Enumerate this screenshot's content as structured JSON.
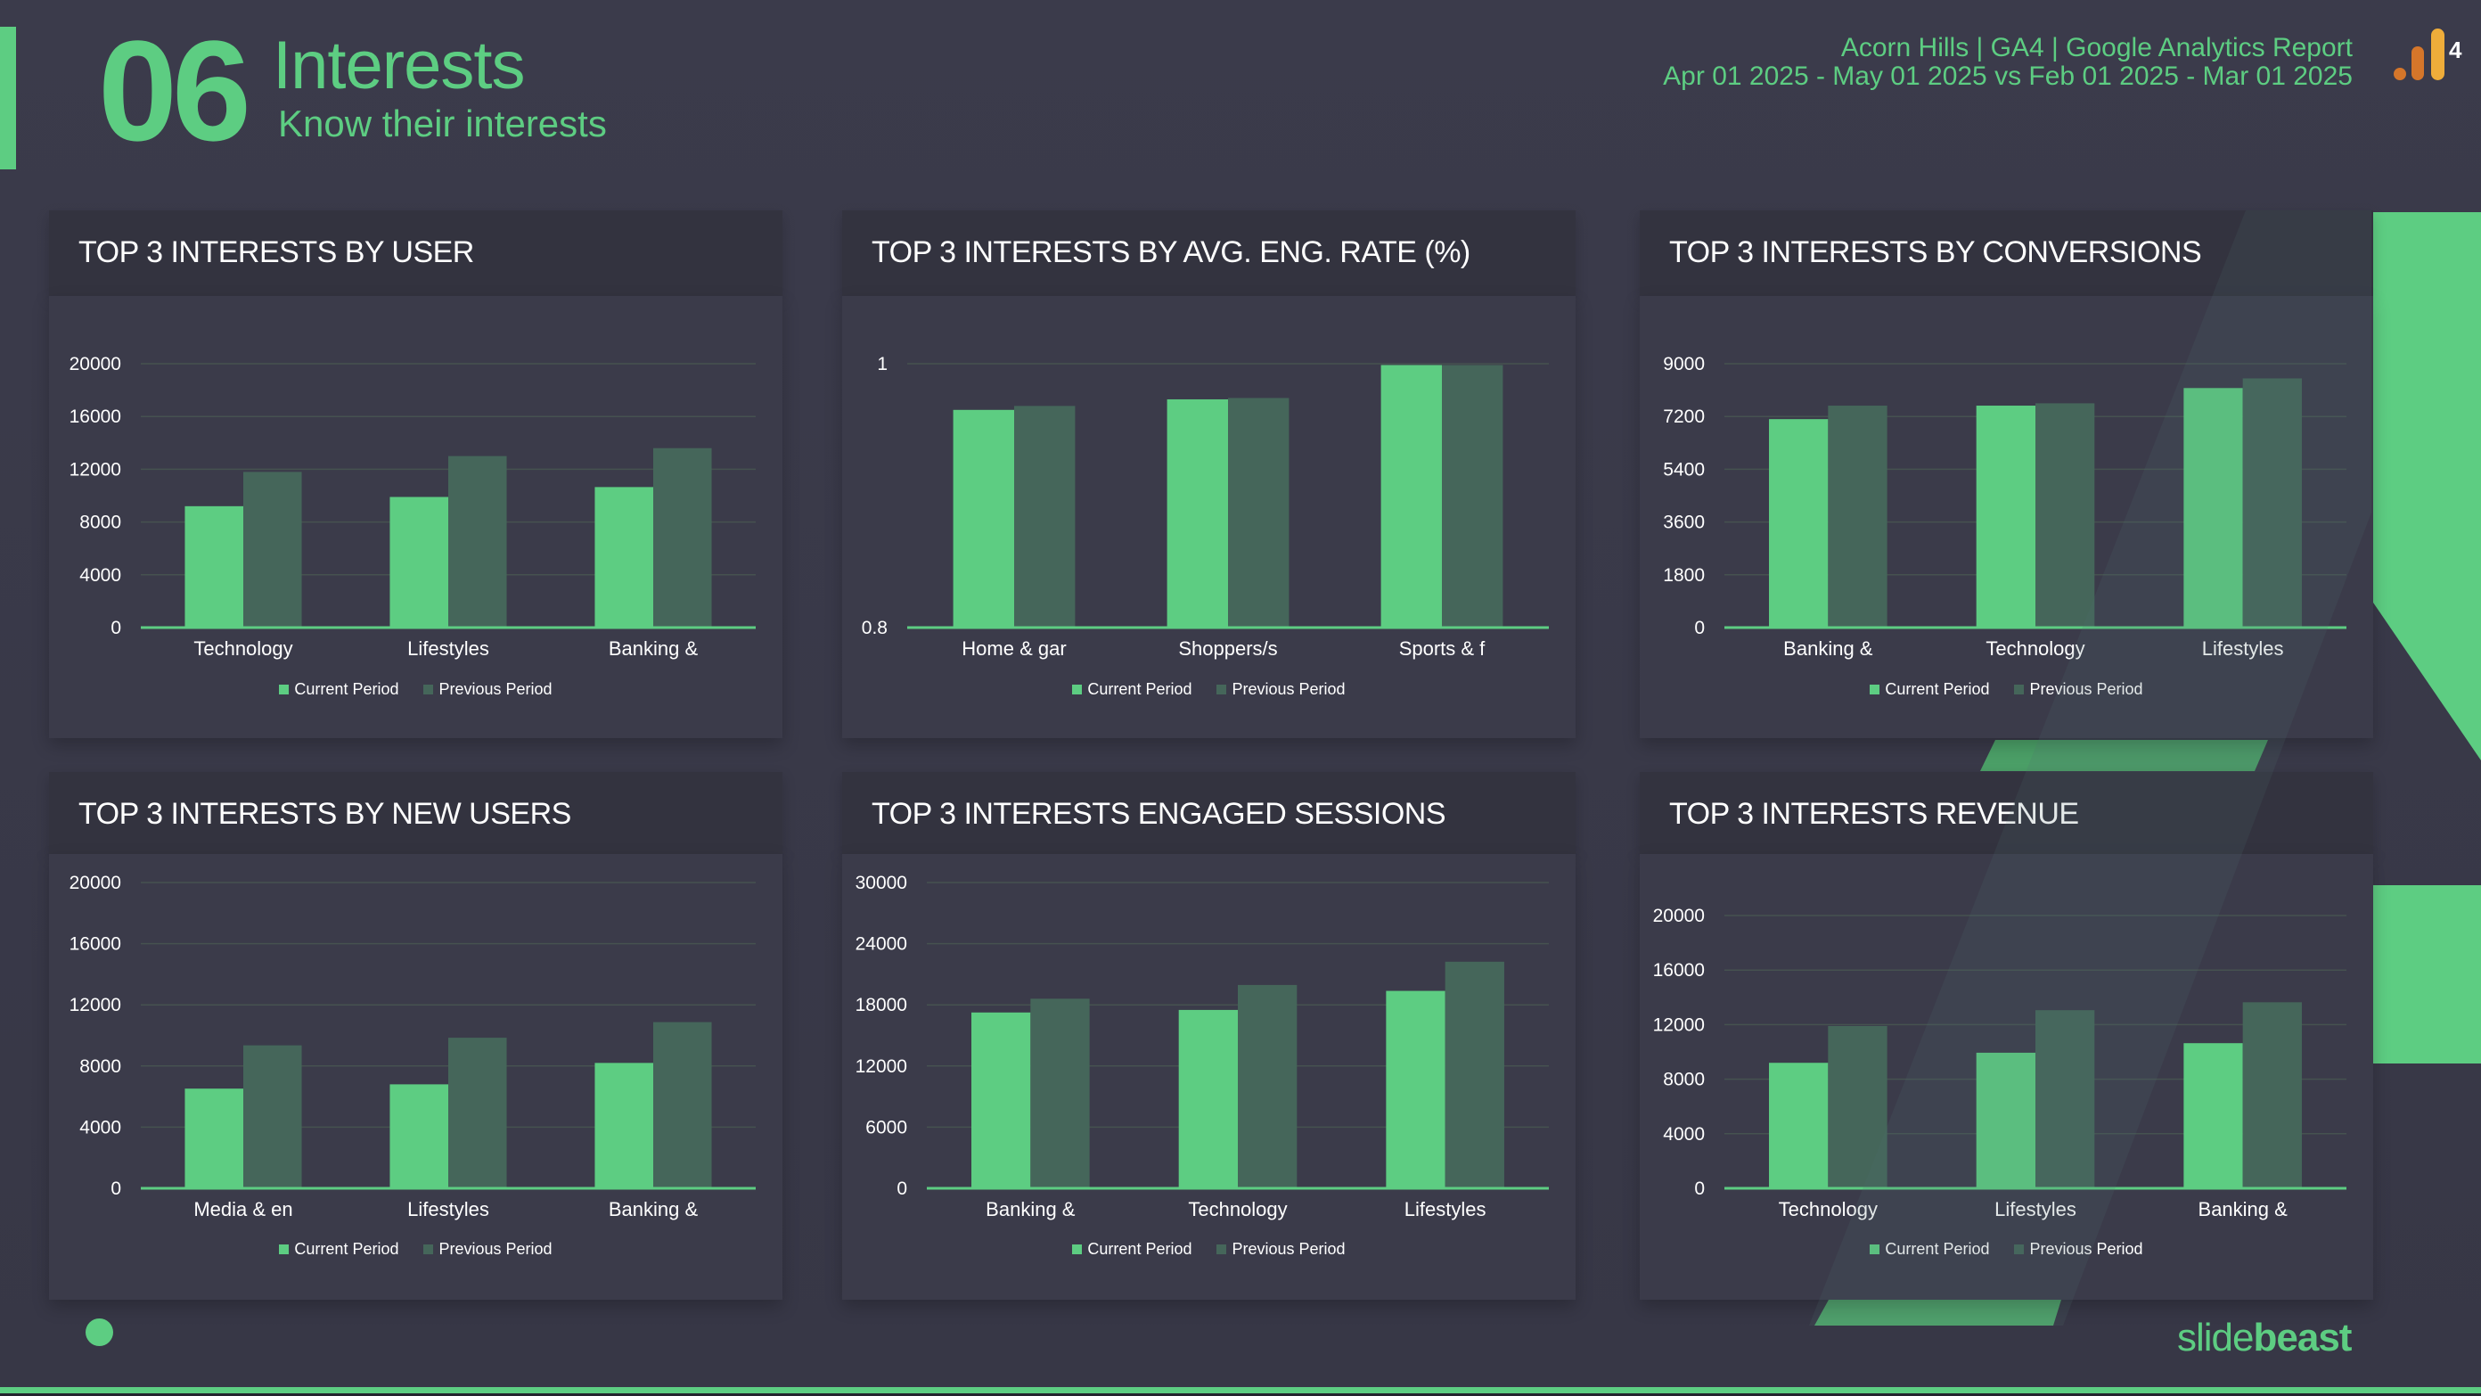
{
  "header": {
    "section_number": "06",
    "title": "Interests",
    "subtitle": "Know their interests",
    "report_title": "Acorn Hills | GA4 | Google Analytics Report",
    "date_range": "Apr 01 2025 - May 01 2025 vs Feb 01 2025 - Mar 01 2025",
    "logo_icon": "google-analytics-4-icon",
    "logo_badge": "4"
  },
  "footer": {
    "brand_light": "slide",
    "brand_bold": "beast"
  },
  "colors": {
    "accent": "#5dcd82",
    "current_period": "#5dcd82",
    "previous_period": "#45665a",
    "background": "#3a3a4a",
    "panel_header": "#33333f",
    "panel_body": "#3b3b4a",
    "ga_orange_dark": "#d5762a",
    "ga_orange_light": "#efad3a"
  },
  "legend": {
    "current": "Current Period",
    "previous": "Previous Period"
  },
  "chart_data": [
    {
      "id": "users",
      "type": "bar",
      "title": "TOP 3 INTERESTS BY USER",
      "categories": [
        "Technology",
        "Lifestyles",
        "Banking &"
      ],
      "series": [
        {
          "name": "Current Period",
          "values": [
            9200,
            9900,
            10650
          ]
        },
        {
          "name": "Previous Period",
          "values": [
            11800,
            13000,
            13600
          ]
        }
      ],
      "ylim": [
        0,
        20000
      ],
      "yticks": [
        "0",
        "4000",
        "8000",
        "12000",
        "16000",
        "20000"
      ],
      "ytick_values": [
        0,
        4000,
        8000,
        12000,
        16000,
        20000
      ],
      "xlabel": "",
      "ylabel": "",
      "grid": true,
      "legend": "bottom"
    },
    {
      "id": "eng-rate",
      "type": "bar",
      "title": "TOP 3 INTERESTS BY AVG. ENG. RATE (%)",
      "categories": [
        "Home & gar",
        "Shoppers/s",
        "Sports & f"
      ],
      "series": [
        {
          "name": "Current Period",
          "values": [
            0.965,
            0.973,
            0.999
          ]
        },
        {
          "name": "Previous Period",
          "values": [
            0.968,
            0.974,
            0.999
          ]
        }
      ],
      "ylim": [
        0.8,
        1
      ],
      "yticks": [
        "0.8",
        "1"
      ],
      "ytick_values": [
        0.8,
        1
      ],
      "xlabel": "",
      "ylabel": "",
      "grid": true,
      "legend": "bottom"
    },
    {
      "id": "conversions",
      "type": "bar",
      "title": "TOP 3 INTERESTS BY CONVERSIONS",
      "categories": [
        "Banking &",
        "Technology",
        "Lifestyles"
      ],
      "series": [
        {
          "name": "Current Period",
          "values": [
            7110,
            7570,
            8170
          ]
        },
        {
          "name": "Previous Period",
          "values": [
            7570,
            7650,
            8500
          ]
        }
      ],
      "ylim": [
        0,
        9000
      ],
      "yticks": [
        "0",
        "1800",
        "3600",
        "5400",
        "7200",
        "9000"
      ],
      "ytick_values": [
        0,
        1800,
        3600,
        5400,
        7200,
        9000
      ],
      "xlabel": "",
      "ylabel": "",
      "grid": true,
      "legend": "bottom"
    },
    {
      "id": "new-users",
      "type": "bar",
      "title": "TOP 3 INTERESTS BY NEW USERS",
      "categories": [
        "Media & en",
        "Lifestyles",
        "Banking &"
      ],
      "series": [
        {
          "name": "Current Period",
          "values": [
            6520,
            6800,
            8200
          ]
        },
        {
          "name": "Previous Period",
          "values": [
            9350,
            9850,
            10870
          ]
        }
      ],
      "ylim": [
        0,
        20000
      ],
      "yticks": [
        "0",
        "4000",
        "8000",
        "12000",
        "16000",
        "20000"
      ],
      "ytick_values": [
        0,
        4000,
        8000,
        12000,
        16000,
        20000
      ],
      "xlabel": "",
      "ylabel": "",
      "grid": true,
      "legend": "bottom"
    },
    {
      "id": "engaged-sessions",
      "type": "bar",
      "title": "TOP 3 INTERESTS ENGAGED SESSIONS",
      "categories": [
        "Banking &",
        "Technology",
        "Lifestyles"
      ],
      "series": [
        {
          "name": "Current Period",
          "values": [
            17250,
            17500,
            19370
          ]
        },
        {
          "name": "Previous Period",
          "values": [
            18600,
            19950,
            22230
          ]
        }
      ],
      "ylim": [
        0,
        30000
      ],
      "yticks": [
        "0",
        "6000",
        "12000",
        "18000",
        "24000",
        "30000"
      ],
      "ytick_values": [
        0,
        6000,
        12000,
        18000,
        24000,
        30000
      ],
      "xlabel": "",
      "ylabel": "",
      "grid": true,
      "legend": "bottom"
    },
    {
      "id": "revenue",
      "type": "bar",
      "title": "TOP 3 INTERESTS REVENUE",
      "categories": [
        "Technology",
        "Lifestyles",
        "Banking &"
      ],
      "series": [
        {
          "name": "Current Period",
          "values": [
            9200,
            9940,
            10640
          ]
        },
        {
          "name": "Previous Period",
          "values": [
            11900,
            13060,
            13640
          ]
        }
      ],
      "ylim": [
        0,
        20000
      ],
      "yticks": [
        "0",
        "4000",
        "8000",
        "12000",
        "16000",
        "20000"
      ],
      "ytick_values": [
        0,
        4000,
        8000,
        12000,
        16000,
        20000
      ],
      "xlabel": "",
      "ylabel": "",
      "grid": true,
      "legend": "bottom"
    }
  ]
}
